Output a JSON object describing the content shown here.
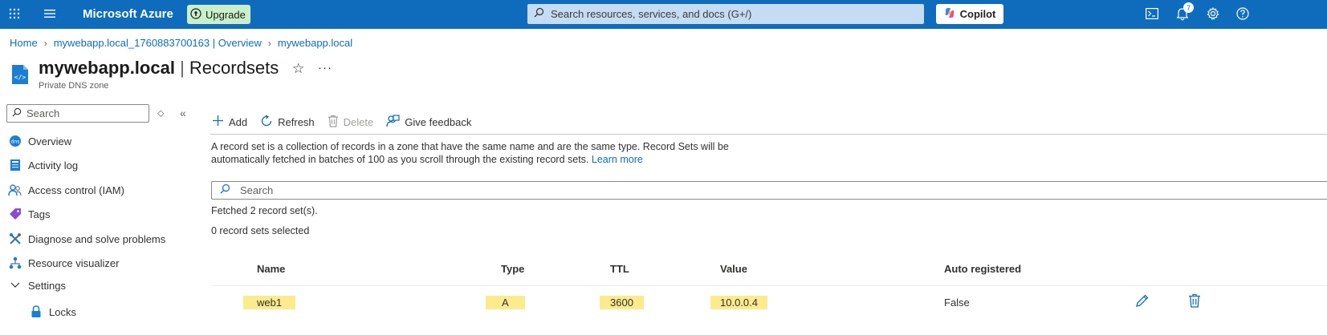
{
  "topbar": {
    "brand": "Microsoft Azure",
    "upgrade_label": "Upgrade",
    "search_placeholder": "Search resources, services, and docs (G+/)",
    "copilot_label": "Copilot",
    "notification_count": "7"
  },
  "breadcrumb": {
    "items": [
      "Home",
      "mywebapp.local_1760883700163 | Overview",
      "mywebapp.local"
    ]
  },
  "header": {
    "resource_name": "mywebapp.local",
    "separator": "|",
    "blade_name": "Recordsets",
    "subtitle": "Private DNS zone"
  },
  "sidebar": {
    "search_placeholder": "Search",
    "items": [
      {
        "label": "Overview",
        "icon": "dns-zone-icon"
      },
      {
        "label": "Activity log",
        "icon": "activity-log-icon"
      },
      {
        "label": "Access control (IAM)",
        "icon": "people-icon"
      },
      {
        "label": "Tags",
        "icon": "tag-icon"
      },
      {
        "label": "Diagnose and solve problems",
        "icon": "wrench-icon"
      },
      {
        "label": "Resource visualizer",
        "icon": "hierarchy-icon"
      },
      {
        "label": "Settings",
        "icon": "chevron-down-icon"
      },
      {
        "label": "Locks",
        "icon": "lock-icon"
      }
    ]
  },
  "toolbar": {
    "add_label": "Add",
    "refresh_label": "Refresh",
    "delete_label": "Delete",
    "feedback_label": "Give feedback"
  },
  "main": {
    "description": "A record set is a collection of records in a zone that have the same name and are the same type. Record Sets will be automatically fetched in batches of 100 as you scroll through the existing record sets.",
    "learn_more": "Learn more",
    "search_placeholder": "Search",
    "fetched_text": "Fetched 2 record set(s).",
    "selected_text": "0 record sets selected"
  },
  "table": {
    "columns": [
      "Name",
      "Type",
      "TTL",
      "Value",
      "Auto registered"
    ],
    "rows": [
      {
        "name": "web1",
        "type": "A",
        "ttl": "3600",
        "value": "10.0.0.4",
        "auto_registered": "False"
      }
    ]
  },
  "colors": {
    "accent": "#0f6cbd",
    "highlight": "#fbeb8c",
    "upgrade_bg": "#c9f0c9"
  }
}
